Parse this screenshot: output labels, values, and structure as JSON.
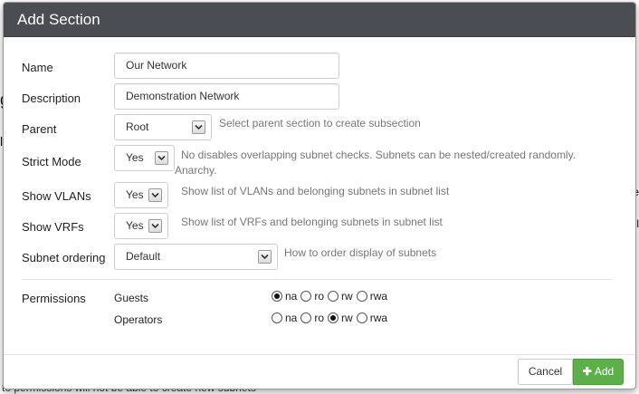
{
  "modal": {
    "title": "Add Section"
  },
  "form": {
    "name": {
      "label": "Name",
      "value": "Our Network"
    },
    "description": {
      "label": "Description",
      "value": "Demonstration Network"
    },
    "parent": {
      "label": "Parent",
      "value": "Root",
      "help": "Select parent section to create subsection"
    },
    "strict_mode": {
      "label": "Strict Mode",
      "value": "Yes",
      "help_line1": "No disables overlapping subnet checks. Subnets can be nested/created randomly.",
      "help_line2": "Anarchy."
    },
    "show_vlans": {
      "label": "Show VLANs",
      "value": "Yes",
      "help": "Show list of VLANs and belonging subnets in subnet list"
    },
    "show_vrfs": {
      "label": "Show VRFs",
      "value": "Yes",
      "help": "Show list of VRFs and belonging subnets in subnet list"
    },
    "subnet_ordering": {
      "label": "Subnet ordering",
      "value": "Default",
      "help": "How to order display of subnets"
    }
  },
  "permissions": {
    "label": "Permissions",
    "options": [
      "na",
      "ro",
      "rw",
      "rwa"
    ],
    "groups": [
      {
        "name": "Guests",
        "selected": "na"
      },
      {
        "name": "Operators",
        "selected": "rw"
      }
    ]
  },
  "footer": {
    "cancel_label": "Cancel",
    "add_label": "Add"
  },
  "background": {
    "peek_left_1": "g",
    "peek_left_2": "l",
    "peek_right_1": "e",
    "peek_right_2": "l",
    "bottom_text": "to permissions will not be able to create new subnets"
  }
}
